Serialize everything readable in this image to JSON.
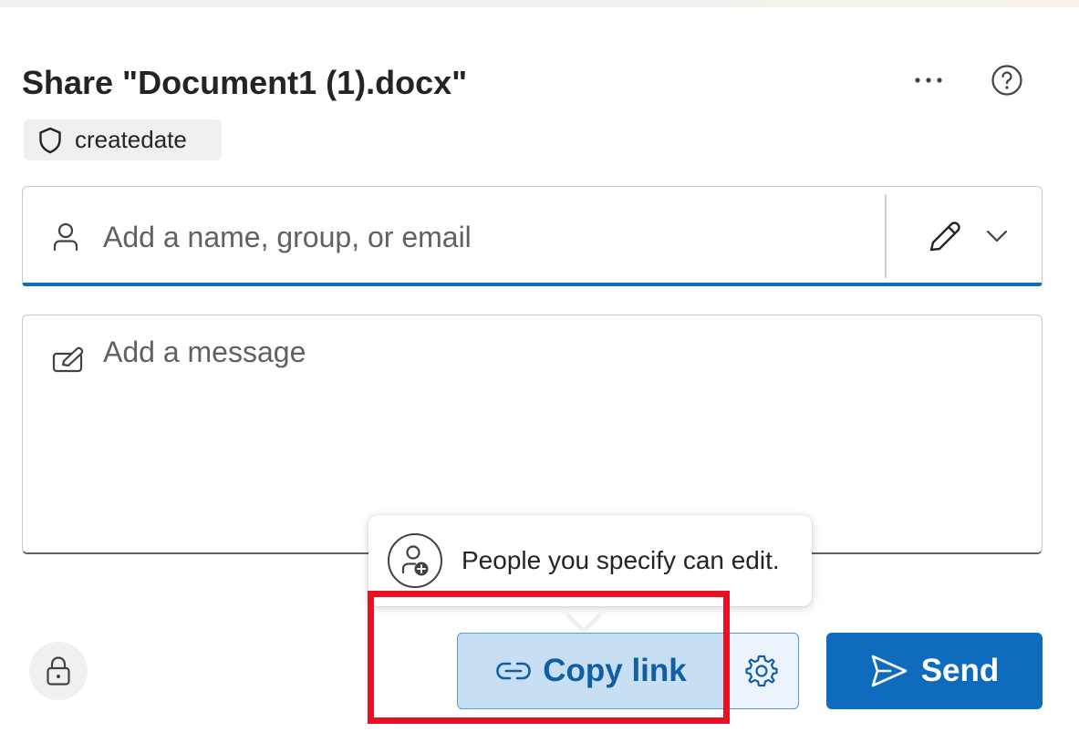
{
  "dialog": {
    "title": "Share \"Document1 (1).docx\"",
    "more_icon": "more-horizontal-icon",
    "help_icon": "question-circle-icon"
  },
  "sensitivity_label": {
    "icon": "shield-icon",
    "text": "createdate"
  },
  "people_field": {
    "icon": "person-icon",
    "placeholder": "Add a name, group, or email",
    "permission_icon": "pencil-icon",
    "dropdown_icon": "chevron-down-icon"
  },
  "message_field": {
    "icon": "compose-icon",
    "placeholder": "Add a message"
  },
  "tooltip": {
    "icon": "person-add-icon",
    "text": "People you specify can edit."
  },
  "footer": {
    "lock_icon": "lock-icon",
    "copy_link_label": "Copy link",
    "copy_link_icon": "link-icon",
    "settings_icon": "gear-icon",
    "send_label": "Send",
    "send_icon": "send-icon"
  },
  "colors": {
    "accent": "#0f6cbd",
    "copy_link_bg": "#c7dff3",
    "highlight": "#e81123"
  }
}
